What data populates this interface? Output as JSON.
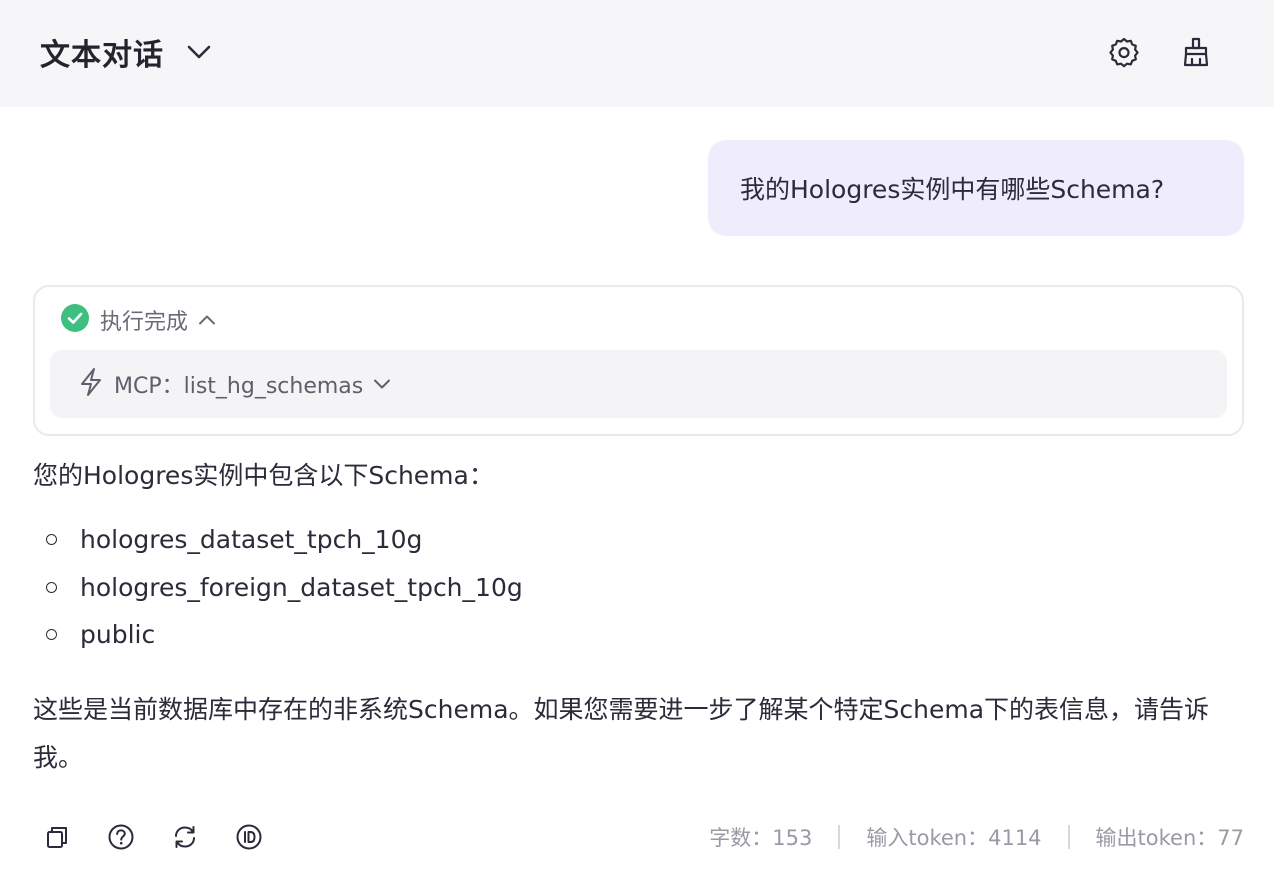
{
  "header": {
    "title": "文本对话",
    "title_icon": "chevron-down-icon",
    "settings_icon": "gear-icon",
    "clear_icon": "broom-icon"
  },
  "conversation": {
    "user_message": "我的Hologres实例中有哪些Schema?",
    "execution": {
      "status_icon": "check-circle-icon",
      "status_color": "#3fbf7f",
      "status_text": "执行完成",
      "tool_icon": "lightning-icon",
      "tool_label": "MCP：list_hg_schemas"
    },
    "answer": {
      "intro": "您的Hologres实例中包含以下Schema：",
      "items": [
        "hologres_dataset_tpch_10g",
        "hologres_foreign_dataset_tpch_10g",
        "public"
      ],
      "outro": "这些是当前数据库中存在的非系统Schema。如果您需要进一步了解某个特定Schema下的表信息，请告诉我。"
    }
  },
  "actions": [
    "copy-icon",
    "help-icon",
    "refresh-icon",
    "id-icon"
  ],
  "stats": {
    "char_count": "字数：153",
    "input_tokens": "输入token：4114",
    "output_tokens": "输出token：77"
  },
  "colors": {
    "user_bubble_bg": "#efedfc",
    "header_bg": "#f6f6f9",
    "accent_check": "#3fbf7f"
  }
}
